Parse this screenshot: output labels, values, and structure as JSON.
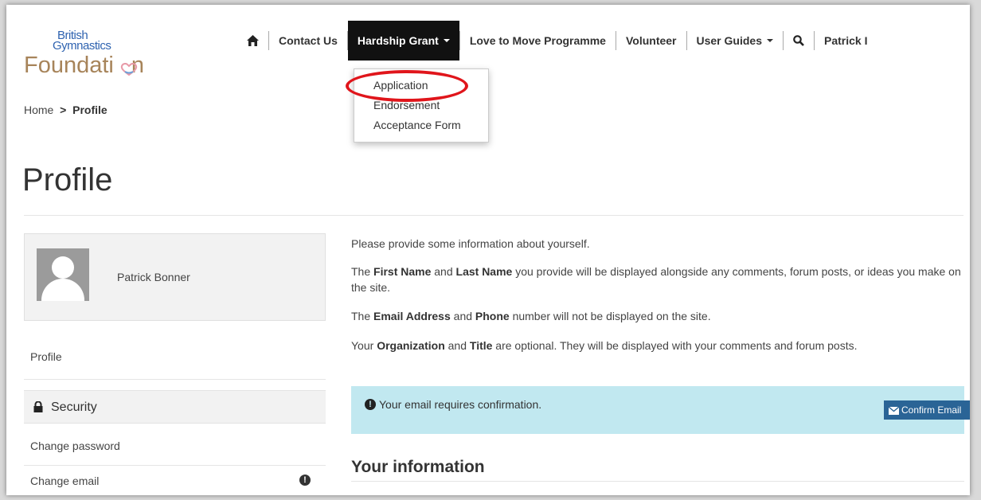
{
  "logo": {
    "line1": "British",
    "line2": "Gymnastics",
    "line3": "Foundati",
    "line3_end": "n"
  },
  "nav": {
    "home_icon": "home-icon",
    "items": [
      {
        "label": "Contact Us"
      },
      {
        "label": "Hardship Grant"
      },
      {
        "label": "Love to Move Programme"
      },
      {
        "label": "Volunteer"
      },
      {
        "label": "User Guides"
      }
    ],
    "search_icon": "search-icon",
    "user": "Patrick I"
  },
  "dropdown": {
    "items": [
      "Application",
      "Endorsement",
      "Acceptance Form"
    ]
  },
  "breadcrumb": {
    "home": "Home",
    "separator": ">",
    "current": "Profile"
  },
  "page_title": "Profile",
  "sidebar": {
    "profile_name": "Patrick Bonner",
    "profile_link": "Profile",
    "security_label": "Security",
    "change_password": "Change password",
    "change_email": "Change email"
  },
  "main": {
    "intro": "Please provide some information about yourself.",
    "p2_a": "The ",
    "p2_b": "First Name",
    "p2_c": " and ",
    "p2_d": "Last Name",
    "p2_e": " you provide will be displayed alongside any comments, forum posts, or ideas you make on the site.",
    "p3_a": "The ",
    "p3_b": "Email Address",
    "p3_c": " and ",
    "p3_d": "Phone",
    "p3_e": " number will not be displayed on the site.",
    "p4_a": "Your ",
    "p4_b": "Organization",
    "p4_c": " and ",
    "p4_d": "Title",
    "p4_e": " are optional. They will be displayed with your comments and forum posts.",
    "alert_text": "Your email requires confirmation.",
    "confirm_button": "Confirm Email",
    "section_title": "Your information"
  },
  "colors": {
    "nav_active_bg": "#111111",
    "alert_bg": "#c1e8f0",
    "confirm_button_bg": "#2a6496",
    "highlight_ring": "#e0151b",
    "logo_blue": "#2f63b0",
    "logo_gold": "#a7845a"
  }
}
